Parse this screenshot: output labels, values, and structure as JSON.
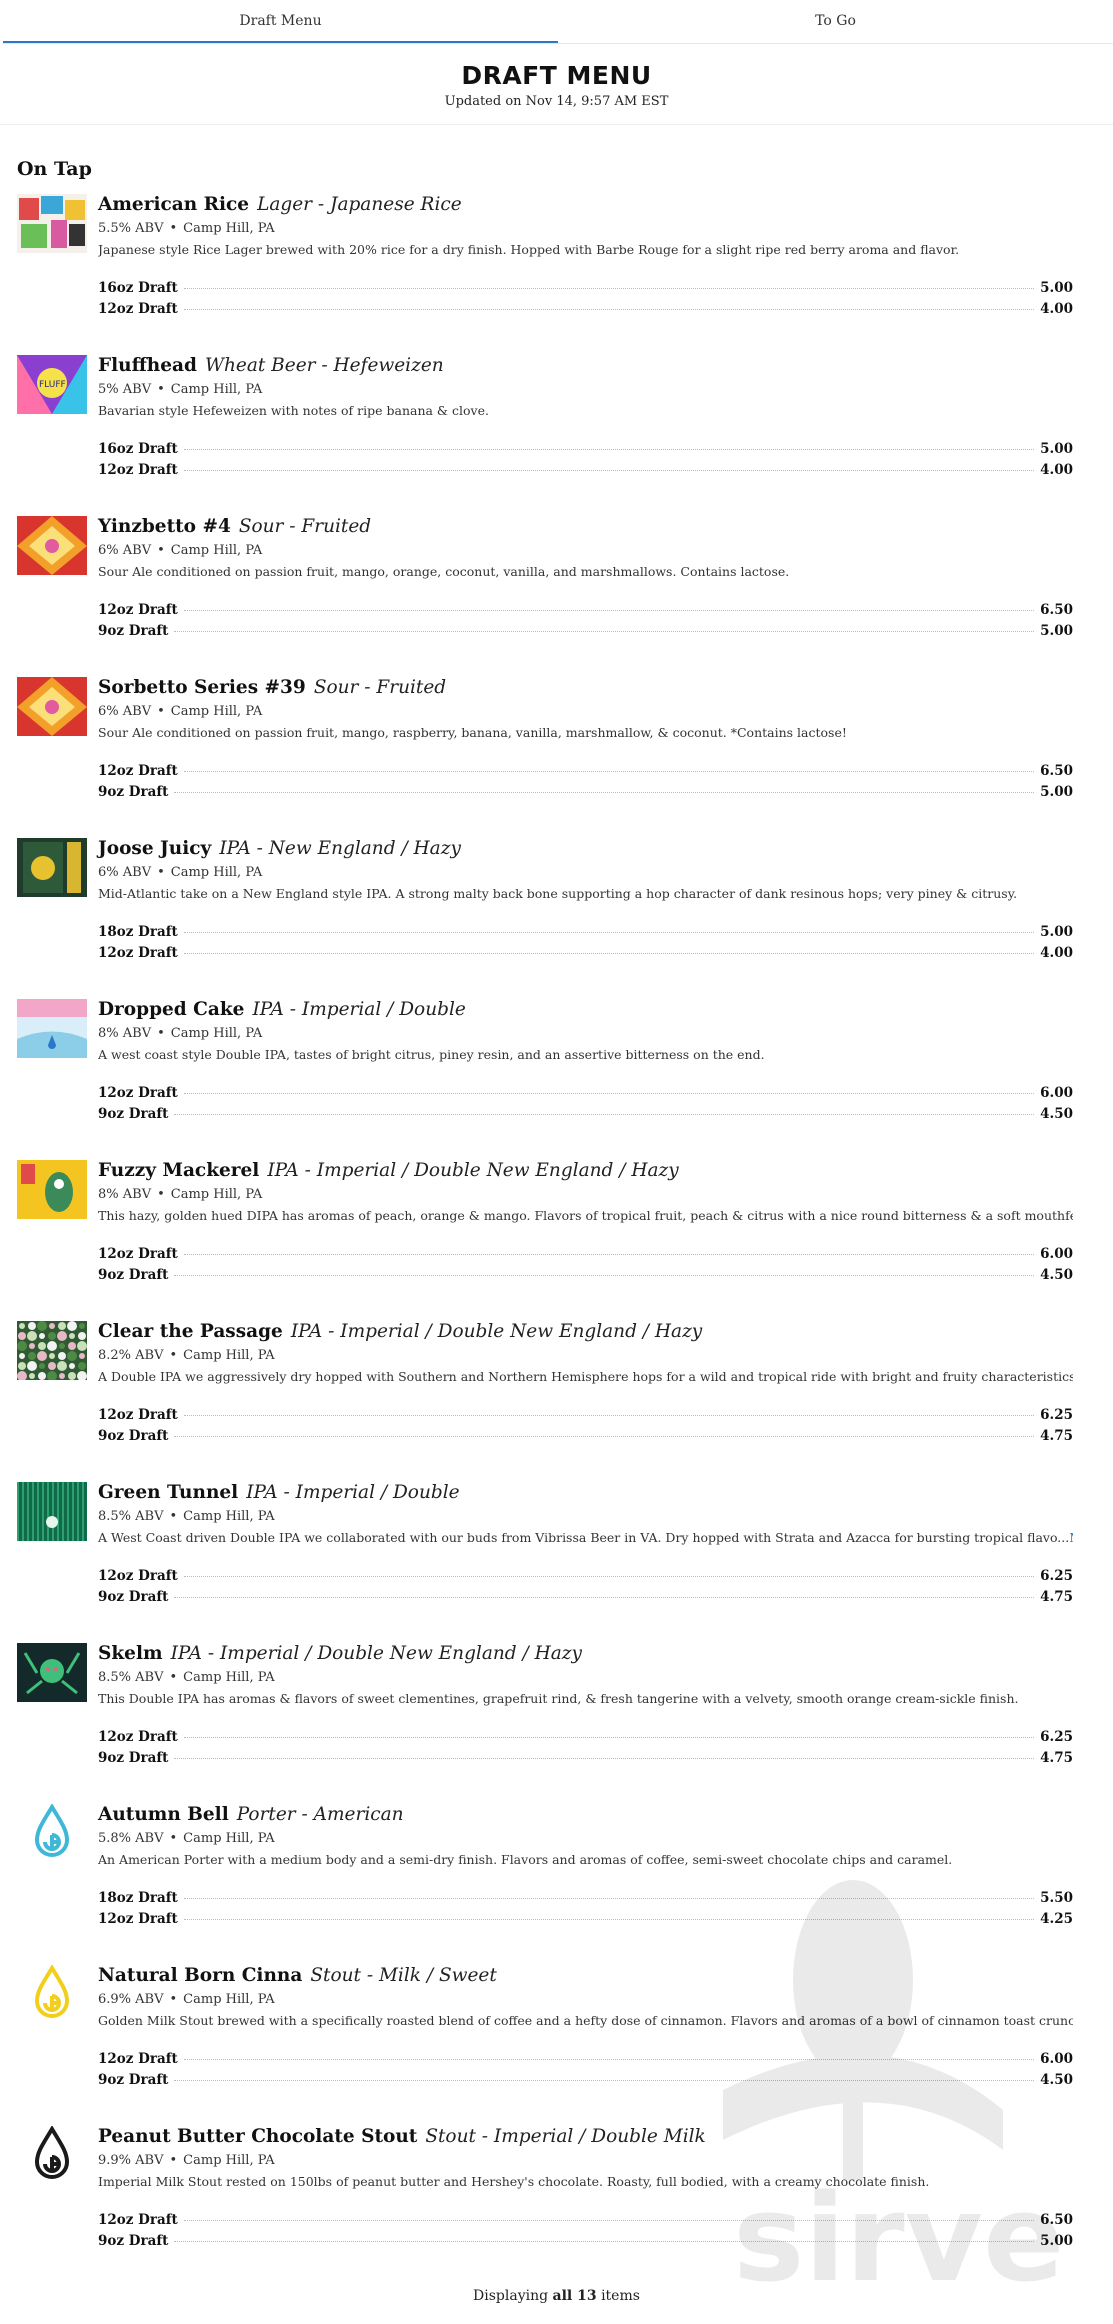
{
  "tabs": [
    {
      "label": "Draft Menu",
      "active": true
    },
    {
      "label": "To Go",
      "active": false
    }
  ],
  "header": {
    "title": "DRAFT MENU",
    "updated": "Updated on Nov 14, 9:57 AM EST"
  },
  "section": {
    "title": "On Tap"
  },
  "items": [
    {
      "name": "American Rice",
      "style": "Lager - Japanese Rice",
      "abv": "5.5% ABV",
      "location": "Camp Hill, PA",
      "desc": "Japanese style Rice Lager brewed with 20% rice for a dry finish. Hopped with Barbe Rouge for a slight ripe red berry aroma and flavor.",
      "prices": [
        {
          "size": "16oz Draft",
          "price": "5.00"
        },
        {
          "size": "12oz Draft",
          "price": "4.00"
        }
      ],
      "thumb": "collage-multicolor"
    },
    {
      "name": "Fluffhead",
      "style": "Wheat Beer - Hefeweizen",
      "abv": "5% ABV",
      "location": "Camp Hill, PA",
      "desc": "Bavarian style Hefeweizen with notes of ripe banana & clove.",
      "prices": [
        {
          "size": "16oz Draft",
          "price": "5.00"
        },
        {
          "size": "12oz Draft",
          "price": "4.00"
        }
      ],
      "thumb": "psychedelic-label"
    },
    {
      "name": "Yinzbetto #4",
      "style": "Sour - Fruited",
      "abv": "6% ABV",
      "location": "Camp Hill, PA",
      "desc": "Sour Ale conditioned on passion fruit, mango, orange, coconut, vanilla, and marshmallows. Contains lactose.",
      "prices": [
        {
          "size": "12oz Draft",
          "price": "6.50"
        },
        {
          "size": "9oz Draft",
          "price": "5.00"
        }
      ],
      "thumb": "sorbetto-red"
    },
    {
      "name": "Sorbetto Series #39",
      "style": "Sour - Fruited",
      "abv": "6% ABV",
      "location": "Camp Hill, PA",
      "desc": "Sour Ale conditioned on passion fruit, mango, raspberry, banana, vanilla, marshmallow, & coconut. *Contains lactose!",
      "prices": [
        {
          "size": "12oz Draft",
          "price": "6.50"
        },
        {
          "size": "9oz Draft",
          "price": "5.00"
        }
      ],
      "thumb": "sorbetto-red"
    },
    {
      "name": "Joose Juicy",
      "style": "IPA - New England / Hazy",
      "abv": "6% ABV",
      "location": "Camp Hill, PA",
      "desc": "Mid-Atlantic take on a New England style IPA. A strong malty back bone supporting a hop character of dank resinous hops; very piney & citrusy.",
      "prices": [
        {
          "size": "18oz Draft",
          "price": "5.00"
        },
        {
          "size": "12oz Draft",
          "price": "4.00"
        }
      ],
      "thumb": "dark-green-label"
    },
    {
      "name": "Dropped Cake",
      "style": "IPA - Imperial / Double",
      "abv": "8% ABV",
      "location": "Camp Hill, PA",
      "desc": "A west coast style Double IPA, tastes of bright citrus, piney resin, and an assertive bitterness on the end.",
      "prices": [
        {
          "size": "12oz Draft",
          "price": "6.00"
        },
        {
          "size": "9oz Draft",
          "price": "4.50"
        }
      ],
      "thumb": "sky-blue"
    },
    {
      "name": "Fuzzy Mackerel",
      "style": "IPA - Imperial / Double New England / Hazy",
      "abv": "8% ABV",
      "location": "Camp Hill, PA",
      "desc": "This hazy, golden hued DIPA has aromas of peach, orange & mango. Flavors of tropical fruit, peach & citrus with a nice round bitterness & a soft mouthfeel.",
      "prices": [
        {
          "size": "12oz Draft",
          "price": "6.00"
        },
        {
          "size": "9oz Draft",
          "price": "4.50"
        }
      ],
      "thumb": "yellow-label"
    },
    {
      "name": "Clear the Passage",
      "style": "IPA - Imperial / Double New England / Hazy",
      "abv": "8.2% ABV",
      "location": "Camp Hill, PA",
      "desc": "A Double IPA we aggressively dry hopped with Southern and Northern Hemisphere hops for a wild and tropical ride with bright and fruity characteristics.",
      "prices": [
        {
          "size": "12oz Draft",
          "price": "6.25"
        },
        {
          "size": "9oz Draft",
          "price": "4.75"
        }
      ],
      "thumb": "green-pattern"
    },
    {
      "name": "Green Tunnel",
      "style": "IPA - Imperial / Double",
      "abv": "8.5% ABV",
      "location": "Camp Hill, PA",
      "desc": "A West Coast driven Double IPA we collaborated with our buds from Vibrissa Beer in VA. Dry hopped with Strata and Azacca for bursting tropical flavo...",
      "more": "More Info ›",
      "prices": [
        {
          "size": "12oz Draft",
          "price": "6.25"
        },
        {
          "size": "9oz Draft",
          "price": "4.75"
        }
      ],
      "thumb": "green-tunnel"
    },
    {
      "name": "Skelm",
      "style": "IPA - Imperial / Double New England / Hazy",
      "abv": "8.5% ABV",
      "location": "Camp Hill, PA",
      "desc": "This Double IPA has aromas & flavors of sweet clementines, grapefruit rind, & fresh tangerine with a velvety, smooth orange cream-sickle finish.",
      "prices": [
        {
          "size": "12oz Draft",
          "price": "6.25"
        },
        {
          "size": "9oz Draft",
          "price": "4.75"
        }
      ],
      "thumb": "dark-creature"
    },
    {
      "name": "Autumn Bell",
      "style": "Porter - American",
      "abv": "5.8% ABV",
      "location": "Camp Hill, PA",
      "desc": "An American Porter with a medium body and a semi-dry finish. Flavors and aromas of coffee, semi-sweet chocolate chips and caramel.",
      "prices": [
        {
          "size": "18oz Draft",
          "price": "5.50"
        },
        {
          "size": "12oz Draft",
          "price": "4.25"
        }
      ],
      "thumb": "drop-logo",
      "logo_color": "#3fb8d8"
    },
    {
      "name": "Natural Born Cinna",
      "style": "Stout - Milk / Sweet",
      "abv": "6.9% ABV",
      "location": "Camp Hill, PA",
      "desc": "Golden Milk Stout brewed with a specifically roasted blend of coffee and a hefty dose of cinnamon. Flavors and aromas of a bowl of cinnamon toast crunch.",
      "prices": [
        {
          "size": "12oz Draft",
          "price": "6.00"
        },
        {
          "size": "9oz Draft",
          "price": "4.50"
        }
      ],
      "thumb": "drop-logo",
      "logo_color": "#f2cf1b"
    },
    {
      "name": "Peanut Butter Chocolate Stout",
      "style": "Stout - Imperial / Double Milk",
      "abv": "9.9% ABV",
      "location": "Camp Hill, PA",
      "desc": "Imperial Milk Stout rested on 150lbs of peanut butter and Hershey's chocolate. Roasty, full bodied, with a creamy chocolate finish.",
      "prices": [
        {
          "size": "12oz Draft",
          "price": "6.50"
        },
        {
          "size": "9oz Draft",
          "price": "5.00"
        }
      ],
      "thumb": "drop-logo",
      "logo_color": "#1a1a1a"
    }
  ],
  "footer": {
    "prefix": "Displaying ",
    "bold": "all 13",
    "suffix": " items"
  },
  "watermark": {
    "text": "sirved"
  }
}
